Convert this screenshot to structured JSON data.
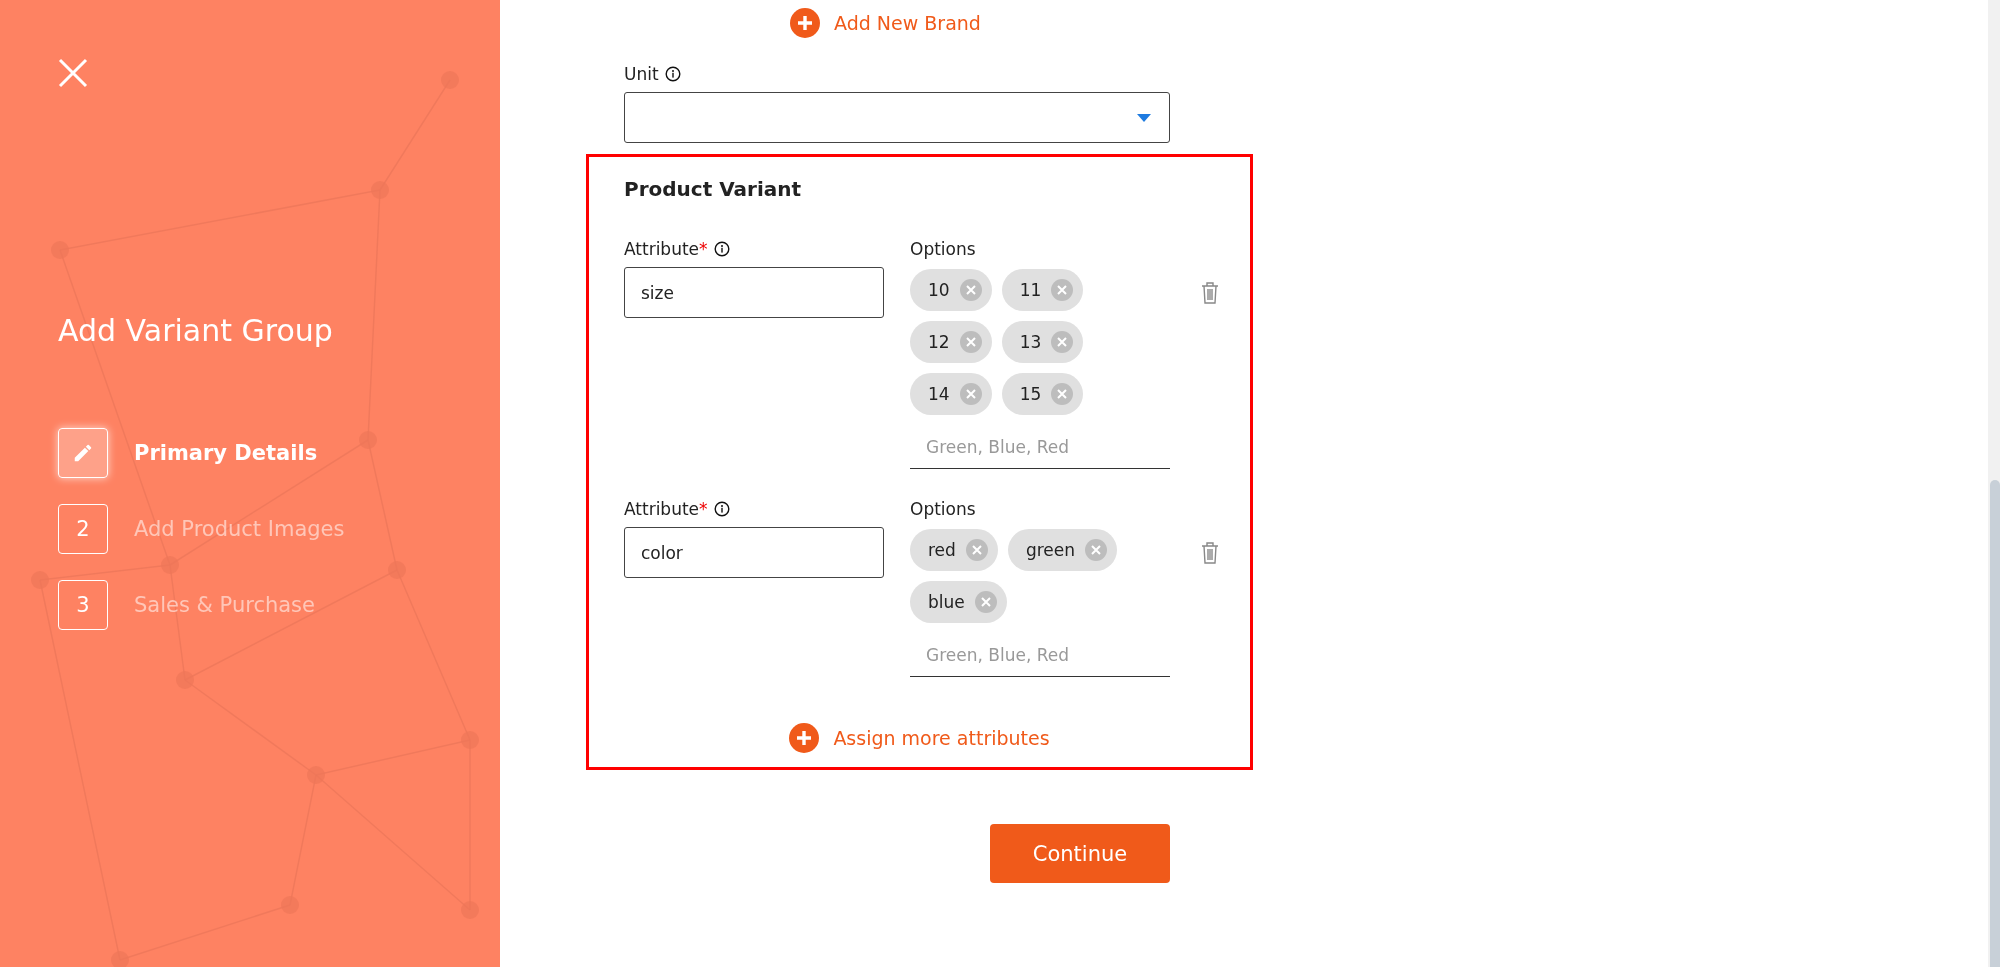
{
  "sidebar": {
    "title": "Add Variant Group",
    "steps": [
      {
        "kind": "icon",
        "label": "Primary Details",
        "selected": true
      },
      {
        "kind": "number",
        "number": "2",
        "label": "Add Product Images",
        "selected": false
      },
      {
        "kind": "number",
        "number": "3",
        "label": "Sales & Purchase",
        "selected": false
      }
    ]
  },
  "add_brand_link": "Add New Brand",
  "unit": {
    "label": "Unit"
  },
  "product_variant": {
    "title": "Product Variant",
    "attributes": [
      {
        "label": "Attribute",
        "required_mark": "*",
        "value": "size",
        "options_label": "Options",
        "options": [
          "10",
          "11",
          "12",
          "13",
          "14",
          "15"
        ],
        "placeholder": "Green, Blue, Red"
      },
      {
        "label": "Attribute",
        "required_mark": "*",
        "value": "color",
        "options_label": "Options",
        "options": [
          "red",
          "green",
          "blue"
        ],
        "placeholder": "Green, Blue, Red"
      }
    ],
    "assign_link": "Assign more attributes"
  },
  "continue_button": "Continue"
}
